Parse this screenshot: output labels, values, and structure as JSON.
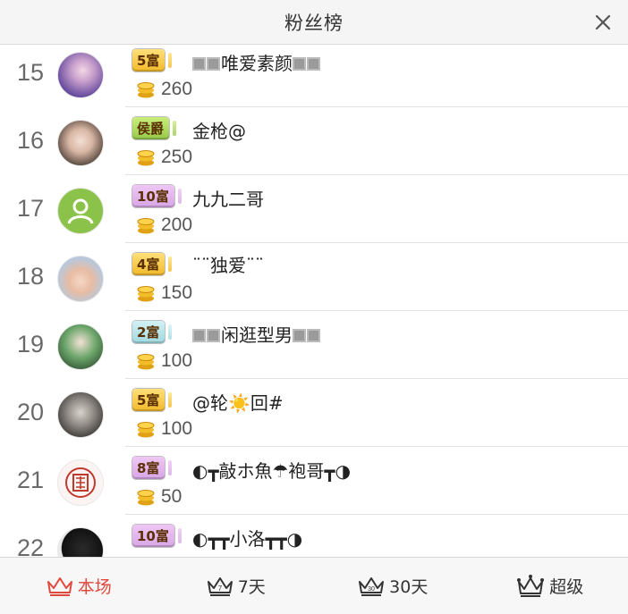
{
  "header": {
    "title": "粉丝榜"
  },
  "rows": [
    {
      "rank": "15",
      "badge": "5富",
      "name": "唯爱素颜",
      "coins": "260"
    },
    {
      "rank": "16",
      "badge": "侯爵",
      "name": "金枪@",
      "coins": "250"
    },
    {
      "rank": "17",
      "badge": "10富",
      "name": "九九二哥",
      "coins": "200"
    },
    {
      "rank": "18",
      "badge": "4富",
      "name": "¨¨独爱¨¨",
      "coins": "150"
    },
    {
      "rank": "19",
      "badge": "2富",
      "name": "闲逛型男",
      "coins": "100"
    },
    {
      "rank": "20",
      "badge": "5富",
      "name": "@轮☀️回#",
      "coins": "100"
    },
    {
      "rank": "21",
      "badge": "8富",
      "name": "◐┳敲ホ魚☂袍哥┳◑",
      "coins": "50"
    },
    {
      "rank": "22",
      "badge": "10富",
      "name": "◐┳┳小洛┳┳◑",
      "coins": ""
    }
  ],
  "tabs": [
    {
      "label": "本场",
      "active": true
    },
    {
      "label": "7天",
      "active": false
    },
    {
      "label": "30天",
      "active": false
    },
    {
      "label": "超级",
      "active": false
    }
  ],
  "colors": {
    "accent": "#e0483e",
    "gold": "#f2b92a",
    "purple": "#d8a6e6",
    "teal": "#9fd8df",
    "green": "#96c94a"
  }
}
